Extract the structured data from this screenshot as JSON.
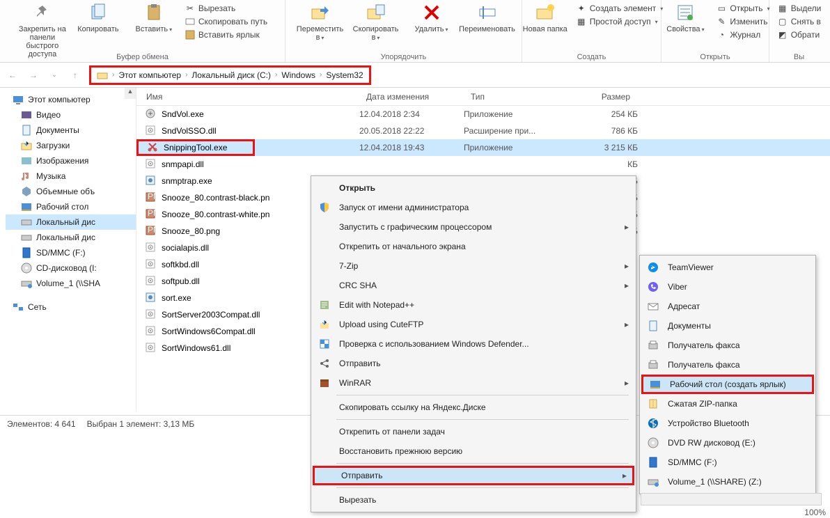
{
  "ribbon": {
    "groups": {
      "clipboard": {
        "label": "Буфер обмена",
        "pin": "Закрепить на панели быстрого доступа",
        "copy": "Копировать",
        "paste": "Вставить",
        "cut": "Вырезать",
        "copy_path": "Скопировать путь",
        "paste_shortcut": "Вставить ярлык"
      },
      "organize": {
        "label": "Упорядочить",
        "move_to": "Переместить в",
        "copy_to": "Скопировать в",
        "delete": "Удалить",
        "rename": "Переименовать"
      },
      "create": {
        "label": "Создать",
        "new_folder": "Новая папка",
        "new_item": "Создать элемент",
        "easy_access": "Простой доступ"
      },
      "open": {
        "label": "Открыть",
        "properties": "Свойства",
        "open": "Открыть",
        "edit": "Изменить",
        "history": "Журнал"
      },
      "select": {
        "select_all": "Выдели",
        "select_none": "Снять в",
        "invert": "Обрати"
      }
    }
  },
  "breadcrumbs": [
    "Этот компьютер",
    "Локальный диск (C:)",
    "Windows",
    "System32"
  ],
  "tree": [
    {
      "label": "Этот компьютер",
      "icon": "pc",
      "top": true
    },
    {
      "label": "Видео",
      "icon": "video"
    },
    {
      "label": "Документы",
      "icon": "docs"
    },
    {
      "label": "Загрузки",
      "icon": "downloads"
    },
    {
      "label": "Изображения",
      "icon": "images"
    },
    {
      "label": "Музыка",
      "icon": "music"
    },
    {
      "label": "Объемные объ",
      "icon": "3d"
    },
    {
      "label": "Рабочий стол",
      "icon": "desktop"
    },
    {
      "label": "Локальный дис",
      "icon": "disk",
      "active": true
    },
    {
      "label": "Локальный дис",
      "icon": "disk"
    },
    {
      "label": "SD/MMC (F:)",
      "icon": "sd"
    },
    {
      "label": "CD-дисковод (I:",
      "icon": "cd"
    },
    {
      "label": "Volume_1 (\\\\SHA",
      "icon": "netdrive"
    },
    {
      "label": "Сеть",
      "icon": "network",
      "top": true
    }
  ],
  "columns": {
    "name": "Имя",
    "date": "Дата изменения",
    "type": "Тип",
    "size": "Размер"
  },
  "files": [
    {
      "name": "SndVol.exe",
      "date": "12.04.2018 2:34",
      "type": "Приложение",
      "size": "254 КБ",
      "ic": "exe"
    },
    {
      "name": "SndVolSSO.dll",
      "date": "20.05.2018 22:22",
      "type": "Расширение при...",
      "size": "786 КБ",
      "ic": "dll"
    },
    {
      "name": "SnippingTool.exe",
      "date": "12.04.2018 19:43",
      "type": "Приложение",
      "size": "3 215 КБ",
      "ic": "snip",
      "sel": true,
      "box": true
    },
    {
      "name": "snmpapi.dll",
      "date": "",
      "type": "",
      "size": "КБ",
      "ic": "dll"
    },
    {
      "name": "snmptrap.exe",
      "date": "",
      "type": "",
      "size": "КБ",
      "ic": "exe2"
    },
    {
      "name": "Snooze_80.contrast-black.pn",
      "date": "",
      "type": "",
      "size": "КБ",
      "ic": "png"
    },
    {
      "name": "Snooze_80.contrast-white.pn",
      "date": "",
      "type": "",
      "size": "КБ",
      "ic": "png"
    },
    {
      "name": "Snooze_80.png",
      "date": "",
      "type": "",
      "size": "КБ",
      "ic": "png"
    },
    {
      "name": "socialapis.dll",
      "date": "",
      "type": "",
      "size": "",
      "ic": "dll"
    },
    {
      "name": "softkbd.dll",
      "date": "",
      "type": "",
      "size": "",
      "ic": "dll"
    },
    {
      "name": "softpub.dll",
      "date": "",
      "type": "",
      "size": "",
      "ic": "dll"
    },
    {
      "name": "sort.exe",
      "date": "",
      "type": "",
      "size": "",
      "ic": "exe2"
    },
    {
      "name": "SortServer2003Compat.dll",
      "date": "",
      "type": "",
      "size": "",
      "ic": "dll"
    },
    {
      "name": "SortWindows6Compat.dll",
      "date": "",
      "type": "",
      "size": "",
      "ic": "dll"
    },
    {
      "name": "SortWindows61.dll",
      "date": "",
      "type": "",
      "size": "",
      "ic": "dll"
    }
  ],
  "status": {
    "items": "Элементов: 4 641",
    "selected": "Выбран 1 элемент: 3,13 МБ",
    "zoom": "100%"
  },
  "context": [
    {
      "label": "Открыть",
      "bold": true
    },
    {
      "label": "Запуск от имени администратора",
      "icon": "shield"
    },
    {
      "label": "Запустить с графическим процессором",
      "sub": true
    },
    {
      "label": "Открепить от начального экрана"
    },
    {
      "label": "7-Zip",
      "sub": true
    },
    {
      "label": "CRC SHA",
      "sub": true
    },
    {
      "label": "Edit with Notepad++",
      "icon": "npp"
    },
    {
      "label": "Upload using CuteFTP",
      "icon": "cuteftp",
      "sub": true
    },
    {
      "label": "Проверка с использованием Windows Defender...",
      "icon": "defender"
    },
    {
      "label": "Отправить",
      "icon": "share"
    },
    {
      "label": "WinRAR",
      "icon": "winrar",
      "sub": true
    },
    {
      "sep": true
    },
    {
      "label": "Скопировать ссылку на Яндекс.Диске"
    },
    {
      "sep": true
    },
    {
      "label": "Открепить от панели задач"
    },
    {
      "label": "Восстановить прежнюю версию"
    },
    {
      "sep": true
    },
    {
      "label": "Отправить",
      "sub": true,
      "hl": true,
      "box": true
    },
    {
      "sep": true
    },
    {
      "label": "Вырезать"
    }
  ],
  "submenu": [
    {
      "label": "TeamViewer",
      "icon": "tv"
    },
    {
      "label": "Viber",
      "icon": "viber"
    },
    {
      "label": "Адресат",
      "icon": "mail"
    },
    {
      "label": "Документы",
      "icon": "docs"
    },
    {
      "label": "Получатель факса",
      "icon": "fax"
    },
    {
      "label": "Получатель факса",
      "icon": "fax"
    },
    {
      "label": "Рабочий стол (создать ярлык)",
      "icon": "desktop",
      "hl": true,
      "box": true
    },
    {
      "label": "Сжатая ZIP-папка",
      "icon": "zip"
    },
    {
      "label": "Устройство Bluetooth",
      "icon": "bt"
    },
    {
      "label": "DVD RW дисковод (E:)",
      "icon": "dvd"
    },
    {
      "label": "SD/MMC (F:)",
      "icon": "sd"
    },
    {
      "label": "Volume_1 (\\\\SHARE) (Z:)",
      "icon": "netdrive"
    }
  ]
}
